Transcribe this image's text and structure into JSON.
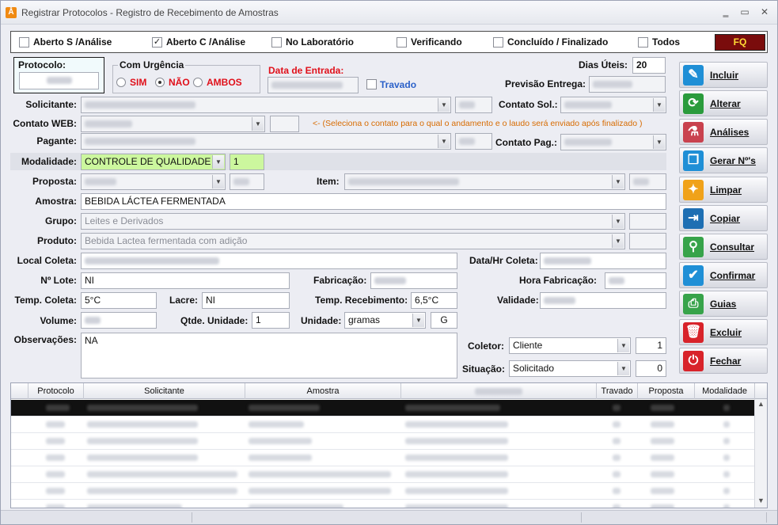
{
  "window": {
    "title": "Registrar Protocolos - Registro de Recebimento de Amostras",
    "minimize": "‗",
    "maximize": "▭",
    "close": "✕",
    "icon": "Å"
  },
  "filters": [
    {
      "label": "Aberto S /Análise",
      "checked": false
    },
    {
      "label": "Aberto C /Análise",
      "checked": true
    },
    {
      "label": "No Laboratório",
      "checked": false
    },
    {
      "label": "Verificando",
      "checked": false
    },
    {
      "label": "Concluído / Finalizado",
      "checked": false
    },
    {
      "label": "Todos",
      "checked": false
    }
  ],
  "fq_button": "FQ",
  "protocolo": {
    "label": "Protocolo:"
  },
  "urgencia": {
    "title": "Com Urgência",
    "options": [
      "SIM",
      "NÃO",
      "AMBOS"
    ],
    "selected": "NÃO"
  },
  "data_entrada": {
    "label": "Data de Entrada:"
  },
  "travado": {
    "label": "Travado",
    "checked": false
  },
  "dias_uteis": {
    "label": "Dias Úteis:",
    "value": "20"
  },
  "previsao": {
    "label": "Previsão Entrega:"
  },
  "solicitante": {
    "label": "Solicitante:"
  },
  "contato_sol": {
    "label": "Contato Sol.:"
  },
  "contato_web": {
    "label": "Contato WEB:",
    "help": "<- (Seleciona o contato para o qual o andamento e o laudo será enviado após finalizado )"
  },
  "pagante": {
    "label": "Pagante:"
  },
  "contato_pag": {
    "label": "Contato Pag.:"
  },
  "modalidade": {
    "label": "Modalidade:",
    "value": "CONTROLE DE QUALIDADE",
    "code": "1"
  },
  "proposta": {
    "label": "Proposta:"
  },
  "item": {
    "label": "Item:"
  },
  "amostra": {
    "label": "Amostra:",
    "value": "BEBIDA LÁCTEA FERMENTADA"
  },
  "grupo": {
    "label": "Grupo:",
    "value": "Leites e Derivados"
  },
  "produto": {
    "label": "Produto:",
    "value": "Bebida Lactea fermentada com adição"
  },
  "local_coleta": {
    "label": "Local Coleta:"
  },
  "data_hr_coleta": {
    "label": "Data/Hr Coleta:"
  },
  "n_lote": {
    "label": "Nº Lote:",
    "value": "NI"
  },
  "fabricacao": {
    "label": "Fabricação:"
  },
  "hora_fabricacao": {
    "label": "Hora Fabricação:"
  },
  "temp_coleta": {
    "label": "Temp. Coleta:",
    "value": "5°C"
  },
  "lacre": {
    "label": "Lacre:",
    "value": "NI"
  },
  "temp_receb": {
    "label": "Temp. Recebimento:",
    "value": "6,5°C"
  },
  "validade": {
    "label": "Validade:"
  },
  "volume": {
    "label": "Volume:"
  },
  "qtde_unidade": {
    "label": "Qtde. Unidade:",
    "value": "1"
  },
  "unidade": {
    "label": "Unidade:",
    "value": "gramas",
    "abbr": "G"
  },
  "observacoes": {
    "label": "Observações:",
    "value": "NA"
  },
  "coletor": {
    "label": "Coletor:",
    "value": "Cliente",
    "code": "1"
  },
  "situacao": {
    "label": "Situação:",
    "value": "Solicitado",
    "code": "0"
  },
  "actions": [
    {
      "label": "Incluir",
      "icon": "add-document-icon",
      "color": "#1f8fd6"
    },
    {
      "label": "Alterar",
      "icon": "refresh-icon",
      "color": "#2a9b3c"
    },
    {
      "label": "Análises",
      "icon": "flask-icon",
      "color": "#c9424e"
    },
    {
      "label": "Gerar Nº's",
      "icon": "copy-icon",
      "color": "#1f8fd6"
    },
    {
      "label": "Limpar",
      "icon": "broom-icon",
      "color": "#f0a21a"
    },
    {
      "label": "Copiar",
      "icon": "copy-arrow-icon",
      "color": "#1e6fb3"
    },
    {
      "label": "Consultar",
      "icon": "search-icon",
      "color": "#37a34a"
    },
    {
      "label": "Confirmar",
      "icon": "check-icon",
      "color": "#1f8fd6"
    },
    {
      "label": "Guias",
      "icon": "printer-icon",
      "color": "#37a34a"
    },
    {
      "label": "Excluir",
      "icon": "trash-icon",
      "color": "#d8232a"
    },
    {
      "label": "Fechar",
      "icon": "power-icon",
      "color": "#d8232a"
    }
  ],
  "grid": {
    "headers": [
      "Protocolo",
      "Solicitante",
      "Amostra",
      "",
      "Travado",
      "Proposta",
      "Modalidade"
    ]
  }
}
